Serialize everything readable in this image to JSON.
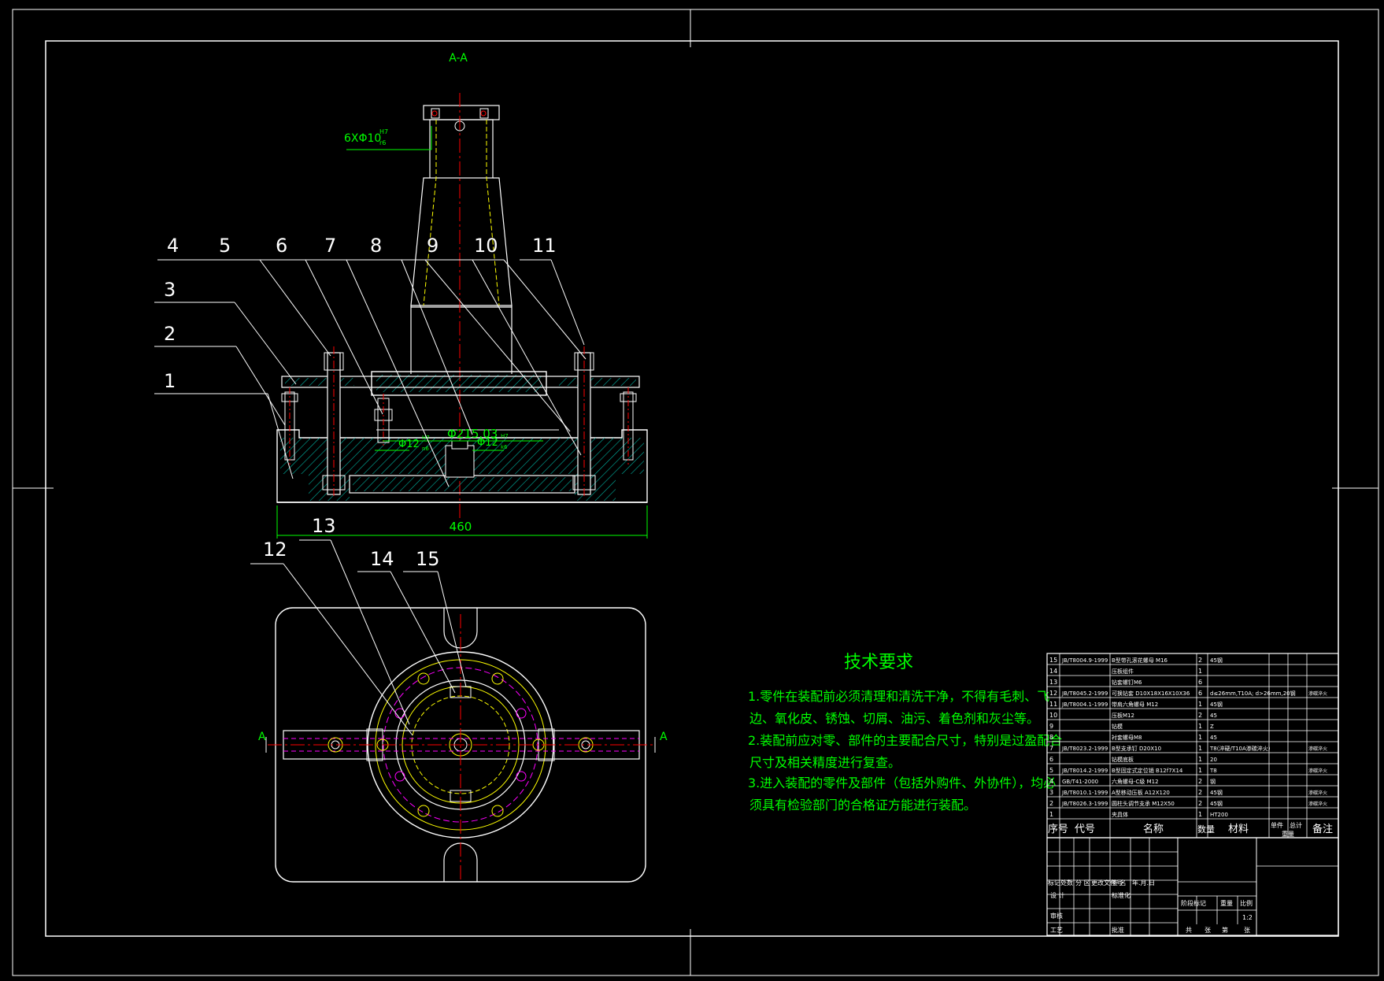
{
  "section_label": "A-A",
  "hole_note_main": "6XΦ10",
  "hole_note_sup": "H7",
  "hole_note_sub": "r6",
  "dims": {
    "width": "460",
    "bore": "Φ215.03",
    "left_fit": "Φ12",
    "left_fit_sup": "H7",
    "left_fit_sub": "n6",
    "right_fit": "Φ12",
    "right_fit_sup": "H7",
    "right_fit_sub": "k6"
  },
  "balloons": [
    "1",
    "2",
    "3",
    "4",
    "5",
    "6",
    "7",
    "8",
    "9",
    "10",
    "11",
    "12",
    "13",
    "14",
    "15"
  ],
  "section_marks": {
    "left": "A",
    "right": "A"
  },
  "tech_title": "技术要求",
  "tech_notes": [
    "1.零件在装配前必须清理和清洗干净，不得有毛刺、飞",
    "边、氧化皮、锈蚀、切屑、油污、着色剂和灰尘等。",
    "2.装配前应对零、部件的主要配合尺寸，特别是过盈配合",
    "尺寸及相关精度进行复查。",
    "3.进入装配的零件及部件（包括外购件、外协件），均必",
    "须具有检验部门的合格证方能进行装配。"
  ],
  "bom_rows": [
    {
      "no": "15",
      "code": "JB/T8004.9-1999",
      "name": "B型带孔滚花螺母 M16",
      "qty": "2",
      "mat": "45钢",
      "note": ""
    },
    {
      "no": "14",
      "code": "",
      "name": "压板组件",
      "qty": "1",
      "mat": "",
      "note": ""
    },
    {
      "no": "13",
      "code": "",
      "name": "钻套螺钉M6",
      "qty": "6",
      "mat": "",
      "note": ""
    },
    {
      "no": "12",
      "code": "JB/T8045.2-1999",
      "name": "可换钻套 D10X18X16X10X36",
      "qty": "6",
      "mat": "d≤26mm,T10A; d>26mm,20钢",
      "note": "渗碳淬火"
    },
    {
      "no": "11",
      "code": "JB/T8004.1-1999",
      "name": "带肩六角螺母 M12",
      "qty": "1",
      "mat": "45钢",
      "note": ""
    },
    {
      "no": "10",
      "code": "",
      "name": "压板M12",
      "qty": "2",
      "mat": "45",
      "note": ""
    },
    {
      "no": "9",
      "code": "",
      "name": "钻模",
      "qty": "1",
      "mat": "Z",
      "note": ""
    },
    {
      "no": "8",
      "code": "",
      "name": "衬套螺母M8",
      "qty": "1",
      "mat": "45",
      "note": ""
    },
    {
      "no": "7",
      "code": "JB/T8023.2-1999",
      "name": "B型支承钉 D20X10",
      "qty": "1",
      "mat": "T8(淬硬/T10A渗碳淬火)",
      "note": "渗碳淬火"
    },
    {
      "no": "6",
      "code": "",
      "name": "钻模底板",
      "qty": "1",
      "mat": "20",
      "note": ""
    },
    {
      "no": "5",
      "code": "JB/T8014.2-1999",
      "name": "B型固定式定位销 B12f7X14",
      "qty": "1",
      "mat": "T8",
      "note": "渗碳淬火"
    },
    {
      "no": "4",
      "code": "GB/T41-2000",
      "name": "六角螺母-C级 M12",
      "qty": "2",
      "mat": "钢",
      "note": ""
    },
    {
      "no": "3",
      "code": "JB/T8010.1-1999",
      "name": "A型移动压板 A12X120",
      "qty": "2",
      "mat": "45钢",
      "note": "渗碳淬火"
    },
    {
      "no": "2",
      "code": "JB/T8026.3-1999",
      "name": "圆柱头调节支承 M12X50",
      "qty": "2",
      "mat": "45钢",
      "note": "渗碳淬火"
    },
    {
      "no": "1",
      "code": "",
      "name": "夹具体",
      "qty": "1",
      "mat": "HT200",
      "note": ""
    }
  ],
  "bom_header": {
    "no": "序号",
    "code": "代号",
    "name": "名称",
    "qty": "数量",
    "mat": "材料",
    "single": "单件",
    "total": "总计",
    "weight": "重量",
    "note": "备注"
  },
  "title_block": {
    "r1": [
      "标记",
      "处数",
      "分 区",
      "更改文件号",
      "签 名",
      "年.月.日"
    ],
    "design": "设 计",
    "std": "标准化",
    "stage": "阶段标记",
    "weight": "重量",
    "scale": "比例",
    "scale_val": "1:2",
    "check": "审核",
    "process": "工艺",
    "approve": "批准",
    "sheets_a": "共",
    "sheets_b": "张",
    "sheets_c": "第",
    "sheets_d": "张"
  },
  "colors": {
    "frame": "#ffffff",
    "dim": "#00ff00",
    "center": "#ff0000",
    "hidden": "#ffff00",
    "hatch": "#00b0a0",
    "magenta": "#ff00ff"
  }
}
